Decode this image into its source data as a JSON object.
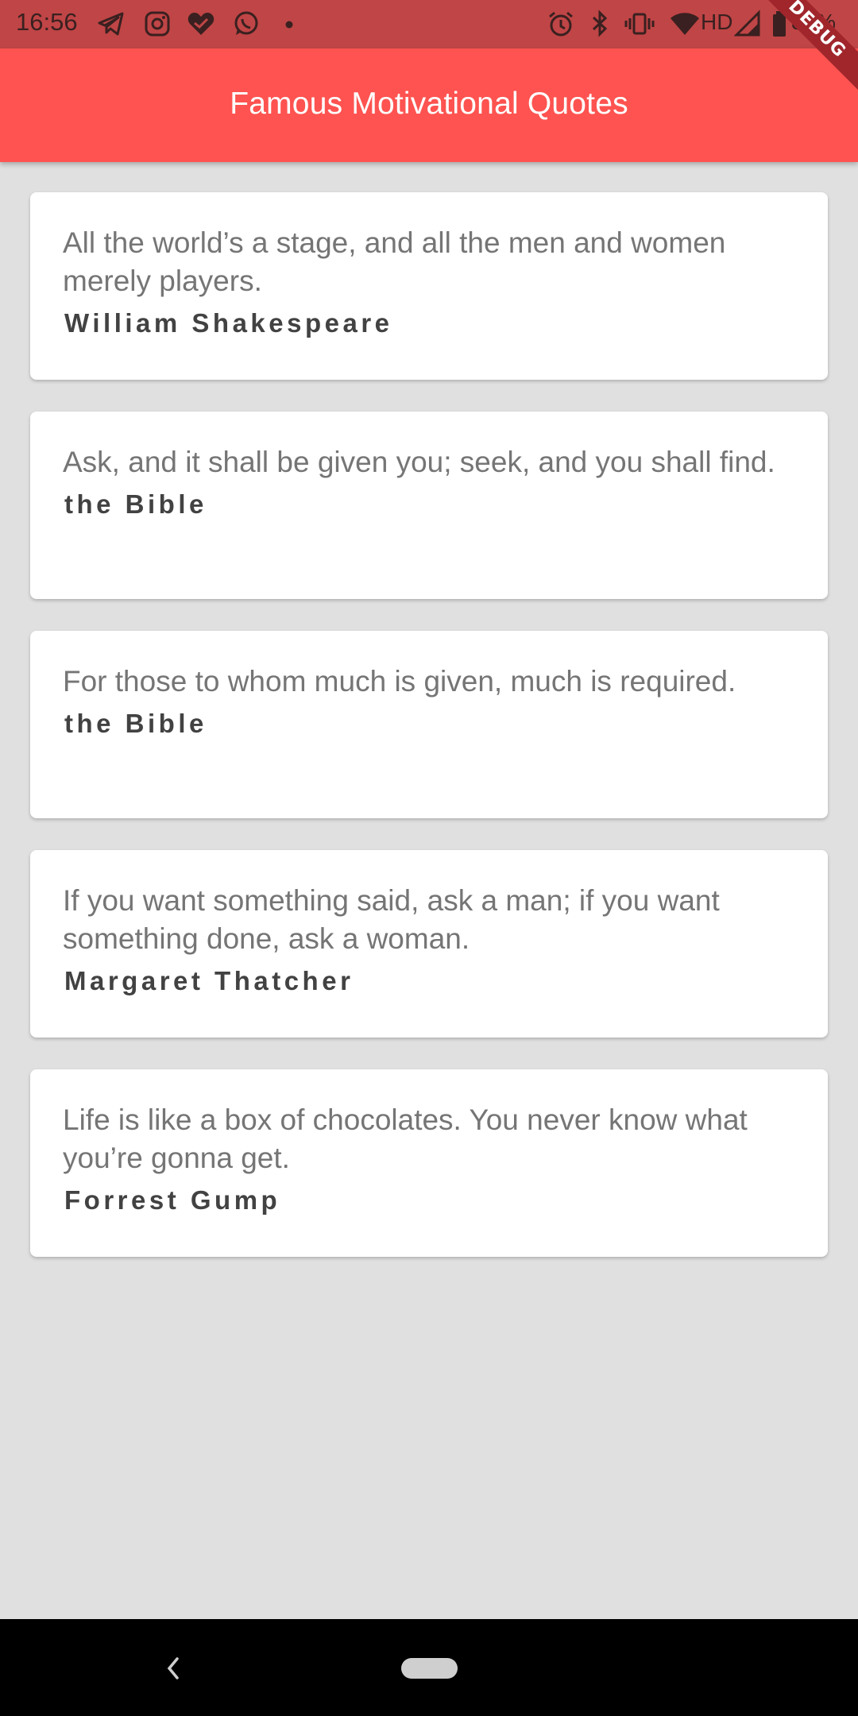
{
  "status_bar": {
    "time": "16:56",
    "network": "HD",
    "battery": "87%",
    "left_icons": [
      "telegram-icon",
      "instagram-icon",
      "heart-check-icon",
      "whatsapp-icon",
      "dot-icon"
    ],
    "right_icons": [
      "alarm-icon",
      "bluetooth-icon",
      "vibrate-icon",
      "wifi-icon",
      "signal-icon",
      "battery-icon"
    ]
  },
  "app_bar": {
    "title": "Famous Motivational Quotes",
    "color": "#fe5350"
  },
  "debug_banner": "DEBUG",
  "quotes": [
    {
      "text": "All the world’s a stage, and all the men and women merely players.",
      "author": "William Shakespeare"
    },
    {
      "text": "Ask, and it shall be given you; seek, and you shall find.",
      "author": "the Bible"
    },
    {
      "text": "For those to whom much is given, much is required.",
      "author": "the Bible"
    },
    {
      "text": "If you want something said, ask a man; if you want something done, ask a woman.",
      "author": "Margaret Thatcher"
    },
    {
      "text": "Life is like a box of chocolates. You never know what you’re gonna get.",
      "author": "Forrest Gump"
    }
  ],
  "nav_bar": {
    "back_icon": "back-chevron-icon",
    "home_icon": "home-pill-icon"
  }
}
